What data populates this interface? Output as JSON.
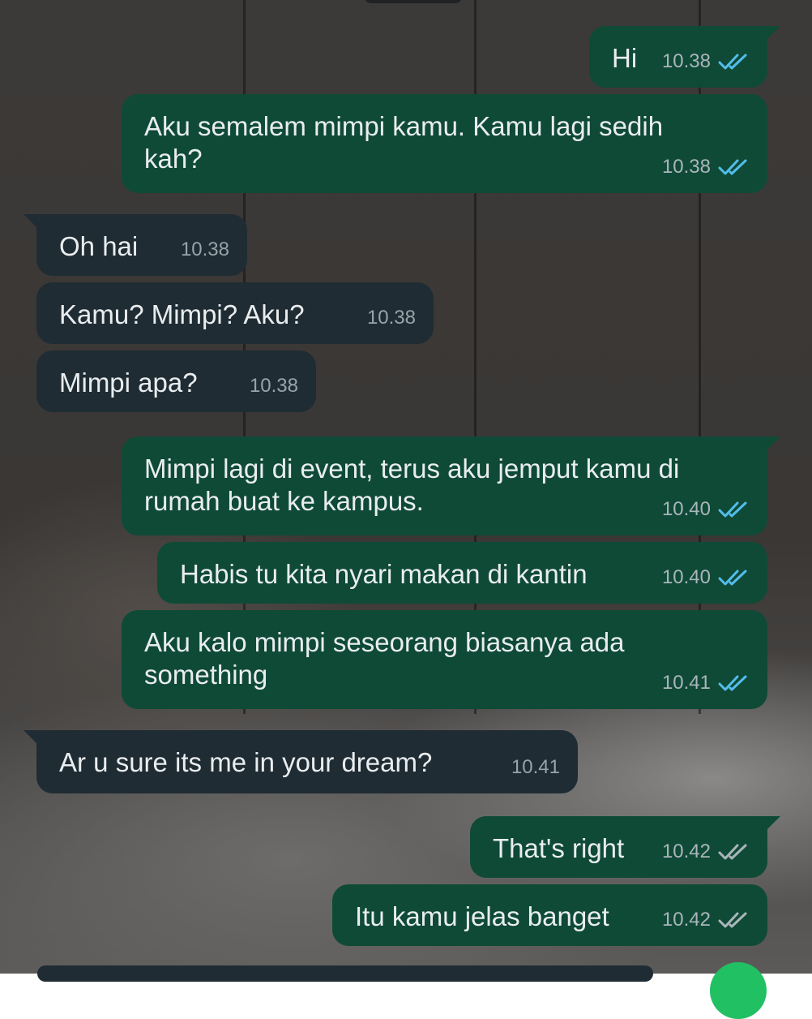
{
  "chat": {
    "messages": [
      {
        "direction": "out",
        "text": "Hi",
        "time": "10.38",
        "status": "read"
      },
      {
        "direction": "out",
        "text": "Aku semalem mimpi kamu. Kamu lagi sedih\nkah?",
        "time": "10.38",
        "status": "read"
      },
      {
        "direction": "in",
        "text": "Oh hai",
        "time": "10.38"
      },
      {
        "direction": "in",
        "text": "Kamu? Mimpi? Aku?",
        "time": "10.38"
      },
      {
        "direction": "in",
        "text": "Mimpi apa?",
        "time": "10.38"
      },
      {
        "direction": "out",
        "text": "Mimpi lagi di event, terus aku jemput kamu di\nrumah buat ke kampus.",
        "time": "10.40",
        "status": "read"
      },
      {
        "direction": "out",
        "text": "Habis tu kita nyari makan di kantin",
        "time": "10.40",
        "status": "read"
      },
      {
        "direction": "out",
        "text": "Aku kalo mimpi seseorang biasanya ada\nsomething",
        "time": "10.41",
        "status": "read"
      },
      {
        "direction": "in",
        "text": "Ar u sure its me in your dream?",
        "time": "10.41"
      },
      {
        "direction": "out",
        "text": "That's right",
        "time": "10.42",
        "status": "delivered"
      },
      {
        "direction": "out",
        "text": "Itu kamu jelas banget",
        "time": "10.42",
        "status": "delivered"
      }
    ]
  },
  "colors": {
    "outgoing_bubble": "#0f4a37",
    "incoming_bubble": "#1f2c33",
    "read_tick": "#53bdeb",
    "delivered_tick": "#aab5ba",
    "fab": "#21c063"
  }
}
